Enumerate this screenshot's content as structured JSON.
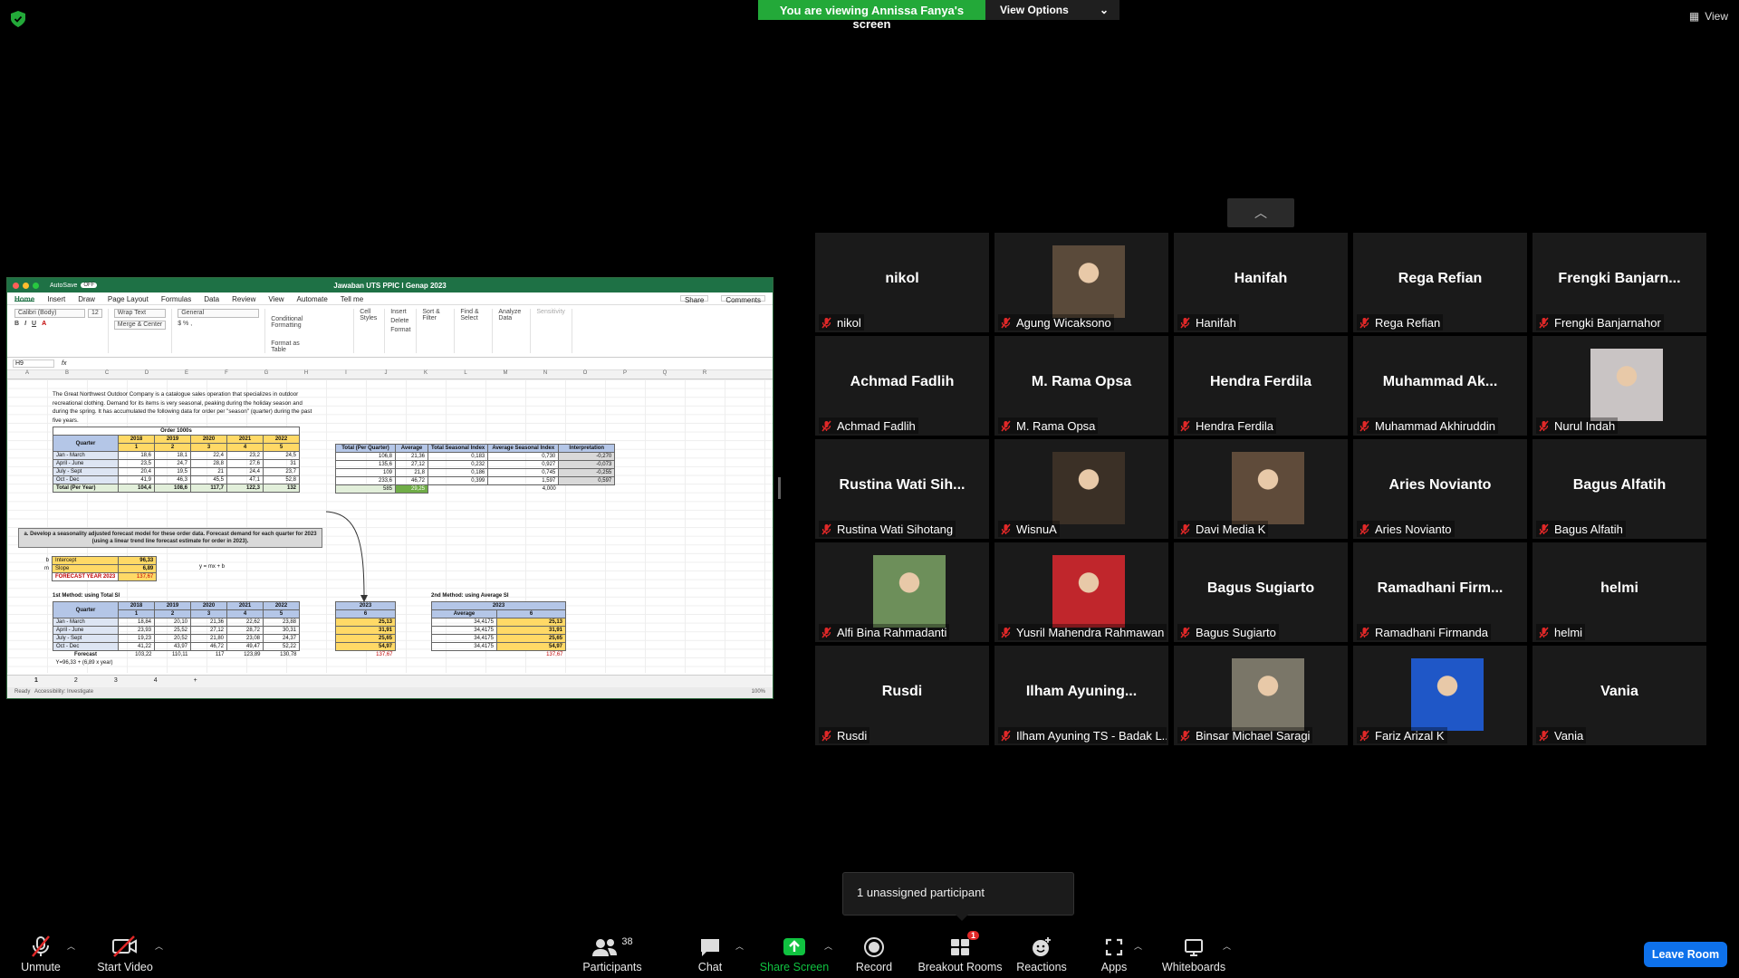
{
  "banner": {
    "message": "You are viewing Annissa Fanya's screen",
    "view_options": "View Options"
  },
  "view_label": "View",
  "excel": {
    "title": "Jawaban UTS PPIC I Genap 2023",
    "autosave": "AutoSave",
    "autosave_state": "OFF",
    "ribbon_tabs": [
      "Home",
      "Insert",
      "Draw",
      "Page Layout",
      "Formulas",
      "Data",
      "Review",
      "View",
      "Automate",
      "Tell me"
    ],
    "share": "Share",
    "comments": "Comments",
    "font_name": "Calibri (Body)",
    "font_size": "12",
    "wrap_text": "Wrap Text",
    "merge_center": "Merge & Center",
    "number_format": "General",
    "ribbon_buttons": [
      "Conditional Formatting",
      "Format as Table",
      "Cell Styles",
      "Insert",
      "Delete",
      "Format",
      "Sort & Filter",
      "Find & Select",
      "Analyze Data",
      "Sensitivity"
    ],
    "cell_ref": "H9",
    "fx": "fx",
    "columns": [
      "A",
      "B",
      "C",
      "D",
      "E",
      "F",
      "G",
      "H",
      "I",
      "J",
      "K",
      "L",
      "M",
      "N",
      "O",
      "P",
      "Q",
      "R"
    ],
    "intro": "The Great Northwest Outdoor Company is a catalogue sales operation that specializes in outdoor recreational clothing. Demand for its items is very seasonal, peaking during the holiday season and during the spring. It has accumulated the following data for order per \"season\" (quarter) during the past five years.",
    "orders_title": "Order 1000s",
    "orders_header": [
      "Quarter",
      "2018",
      "2019",
      "2020",
      "2021",
      "2022"
    ],
    "orders_sub": [
      "",
      "1",
      "2",
      "3",
      "4",
      "5"
    ],
    "orders_rows": [
      {
        "n": "1",
        "q": "Jan - March",
        "v": [
          "18,6",
          "18,1",
          "22,4",
          "23,2",
          "24,5"
        ]
      },
      {
        "n": "2",
        "q": "April - June",
        "v": [
          "23,5",
          "24,7",
          "28,8",
          "27,6",
          "31"
        ]
      },
      {
        "n": "3",
        "q": "July - Sept",
        "v": [
          "20,4",
          "19,5",
          "21",
          "24,4",
          "23,7"
        ]
      },
      {
        "n": "4",
        "q": "Oct - Dec",
        "v": [
          "41,9",
          "46,3",
          "45,5",
          "47,1",
          "52,8"
        ]
      }
    ],
    "orders_total": {
      "q": "Total (Per Year)",
      "v": [
        "104,4",
        "108,6",
        "117,7",
        "122,3",
        "132"
      ]
    },
    "seasonal_header": [
      "Total (Per Quarter)",
      "Average",
      "Total Seasonal Index",
      "Average Seasonal Index",
      "Interpretation"
    ],
    "seasonal_rows": [
      [
        "106,8",
        "21,36",
        "0,183",
        "0,730",
        "-0,270"
      ],
      [
        "135,6",
        "27,12",
        "0,232",
        "0,927",
        "-0,073"
      ],
      [
        "109",
        "21,8",
        "0,186",
        "0,745",
        "-0,255"
      ],
      [
        "233,6",
        "46,72",
        "0,399",
        "1,597",
        "0,597"
      ]
    ],
    "seasonal_total": [
      "585",
      "29,25",
      "",
      "4,000",
      ""
    ],
    "task": "a. Develop a seasonality adjusted forecast model for these order data. Forecast demand for each quarter for 2023 (using a linear trend line forecast estimate for order in 2023).",
    "intercept_label": "Intercept",
    "intercept_prefix": "b",
    "intercept_value": "96,33",
    "slope_label": "Slope",
    "slope_prefix": "m",
    "slope_value": "6,89",
    "forecast_label": "FORECAST YEAR 2023",
    "forecast_value": "137,67",
    "equation": "y = mx + b",
    "method1_title": "1st Method: using Total SI",
    "m1_header": [
      "Quarter",
      "2018",
      "2019",
      "2020",
      "2021",
      "2022"
    ],
    "m1_sub": [
      "",
      "1",
      "2",
      "3",
      "4",
      "5"
    ],
    "m1_rows": [
      {
        "q": "Jan - March",
        "v": [
          "18,84",
          "20,10",
          "21,36",
          "22,62",
          "23,88"
        ]
      },
      {
        "q": "April - June",
        "v": [
          "23,93",
          "25,52",
          "27,12",
          "28,72",
          "30,31"
        ]
      },
      {
        "q": "July - Sept",
        "v": [
          "19,23",
          "20,52",
          "21,80",
          "23,08",
          "24,37"
        ]
      },
      {
        "q": "Oct - Dec",
        "v": [
          "41,22",
          "43,97",
          "46,72",
          "49,47",
          "52,22"
        ]
      }
    ],
    "m1_forecast_label": "Forecast",
    "m1_forecast": [
      "103,22",
      "110,11",
      "117",
      "123,89",
      "130,78"
    ],
    "m1_formula": "Y=96,33 + (6,89 x year)",
    "m1_2023_header": [
      "2023",
      "6"
    ],
    "m1_2023": [
      "25,13",
      "31,91",
      "25,65",
      "54,97"
    ],
    "m1_2023_total": "137,67",
    "method2_title": "2nd Method: using Average SI",
    "m2_header": [
      "2023",
      "Average",
      "6"
    ],
    "m2_rows": [
      [
        "34,4175",
        "25,13"
      ],
      [
        "34,4175",
        "31,91"
      ],
      [
        "34,4175",
        "25,65"
      ],
      [
        "34,4175",
        "54,97"
      ]
    ],
    "m2_total": "137,67",
    "sheet_tabs": [
      "1",
      "2",
      "3",
      "4"
    ],
    "status_ready": "Ready",
    "status_access": "Accessibility: Investigate",
    "zoom": "100%"
  },
  "participants_tiles": [
    {
      "big": "nikol",
      "name": "nikol",
      "photo": false
    },
    {
      "big": "",
      "name": "Agung Wicaksono",
      "photo": true
    },
    {
      "big": "Hanifah",
      "name": "Hanifah",
      "photo": false
    },
    {
      "big": "Rega Refian",
      "name": "Rega Refian",
      "photo": false
    },
    {
      "big": "Frengki  Banjarn...",
      "name": "Frengki Banjarnahor",
      "photo": false
    },
    {
      "big": "Achmad Fadlih",
      "name": "Achmad Fadlih",
      "photo": false
    },
    {
      "big": "M. Rama Opsa",
      "name": "M. Rama Opsa",
      "photo": false
    },
    {
      "big": "Hendra Ferdila",
      "name": "Hendra Ferdila",
      "photo": false
    },
    {
      "big": "Muhammad  Ak...",
      "name": "Muhammad Akhiruddin",
      "photo": false
    },
    {
      "big": "",
      "name": "Nurul Indah",
      "photo": true
    },
    {
      "big": "Rustina Wati Sih...",
      "name": "Rustina Wati Sihotang",
      "photo": false
    },
    {
      "big": "",
      "name": "WisnuA",
      "photo": true
    },
    {
      "big": "",
      "name": "Davi Media K",
      "photo": true
    },
    {
      "big": "Aries Novianto",
      "name": "Aries Novianto",
      "photo": false
    },
    {
      "big": "Bagus Alfatih",
      "name": "Bagus Alfatih",
      "photo": false
    },
    {
      "big": "",
      "name": "Alfi Bina Rahmadanti",
      "photo": true
    },
    {
      "big": "",
      "name": "Yusril Mahendra Rahmawan",
      "photo": true
    },
    {
      "big": "Bagus Sugiarto",
      "name": "Bagus Sugiarto",
      "photo": false
    },
    {
      "big": "Ramadhani  Firm...",
      "name": "Ramadhani Firmanda",
      "photo": false
    },
    {
      "big": "helmi",
      "name": "helmi",
      "photo": false
    },
    {
      "big": "Rusdi",
      "name": "Rusdi",
      "photo": false
    },
    {
      "big": "Ilham  Ayuning...",
      "name": "Ilham Ayuning TS - Badak L...",
      "photo": false
    },
    {
      "big": "",
      "name": "Binsar Michael Saragi",
      "photo": true
    },
    {
      "big": "",
      "name": "Fariz Arizal K",
      "photo": true
    },
    {
      "big": "Vania",
      "name": "Vania",
      "photo": false
    }
  ],
  "photo_colors": [
    "#5a4a3a",
    "#c9c4c4",
    "#3b3026",
    "#5f4b3a",
    "#6d8f5a",
    "#c0262c",
    "#7a7668",
    "#1f57c7"
  ],
  "popup": "1 unassigned participant",
  "toolbar": {
    "unmute": "Unmute",
    "start_video": "Start Video",
    "participants": "Participants",
    "participants_count": "38",
    "chat": "Chat",
    "share_screen": "Share Screen",
    "record": "Record",
    "breakout_rooms": "Breakout Rooms",
    "breakout_badge": "1",
    "reactions": "Reactions",
    "apps": "Apps",
    "whiteboards": "Whiteboards",
    "leave": "Leave Room"
  },
  "colors": {
    "banner_green": "#23a939",
    "leave_blue": "#0e71eb",
    "share_green": "#10c240",
    "mute_red": "#e02828"
  }
}
